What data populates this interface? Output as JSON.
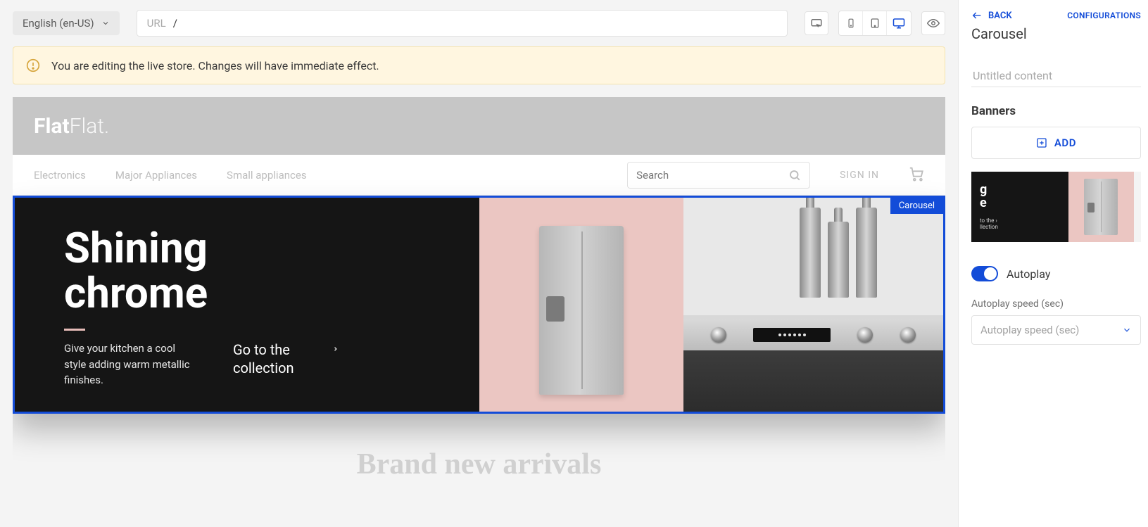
{
  "topbar": {
    "language": "English (en-US)",
    "url_label": "URL",
    "url_value": "/"
  },
  "alert": {
    "message": "You are editing the live store. Changes will have immediate effect."
  },
  "site": {
    "logo_bold": "Flat",
    "logo_light": "Flat.",
    "nav": {
      "electronics": "Electronics",
      "major_appliances": "Major Appliances",
      "small_appliances": "Small appliances"
    },
    "search_placeholder": "Search",
    "signin": "SIGN IN",
    "new_arrivals": "Brand new arrivals"
  },
  "carousel": {
    "tag": "Carousel",
    "title_line1": "Shining",
    "title_line2": "chrome",
    "subtitle": "Give your kitchen a cool style adding warm metallic finishes.",
    "cta": "Go to the collection"
  },
  "sidebar": {
    "back": "BACK",
    "configurations": "CONFIGURATIONS",
    "title": "Carousel",
    "content_placeholder": "Untitled content",
    "banners_heading": "Banners",
    "add_button": "ADD",
    "thumb_title_line1": "g",
    "thumb_title_line2": "e",
    "thumb_sub_line1": "to the",
    "thumb_sub_line2": "llection",
    "autoplay_label": "Autoplay",
    "autoplay_on": true,
    "autoplay_speed_label": "Autoplay speed (sec)",
    "autoplay_speed_placeholder": "Autoplay speed (sec)"
  }
}
